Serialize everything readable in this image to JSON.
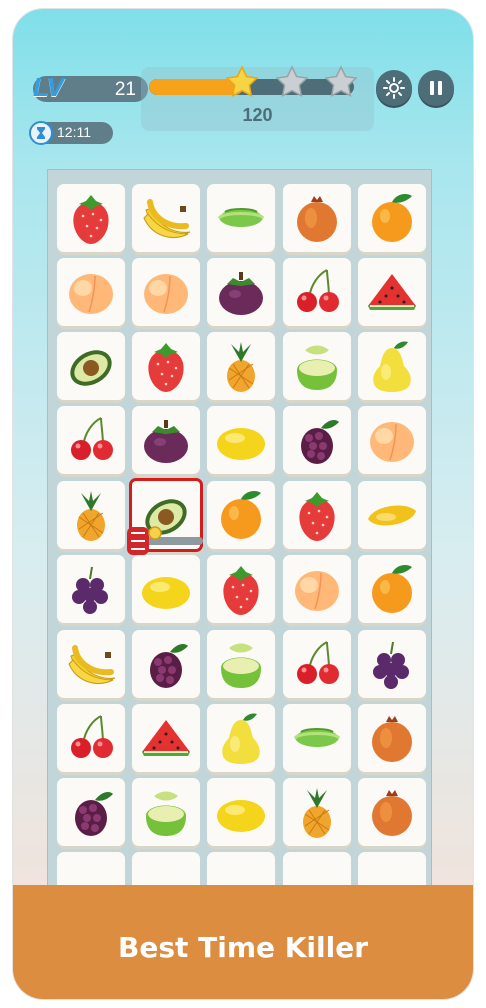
{
  "hud": {
    "level_label": "LV",
    "level": "21",
    "timer": "12:11",
    "score": "120",
    "progress": 0.46,
    "stars_earned": 1,
    "stars_total": 3
  },
  "board": {
    "selected": {
      "row": 4,
      "col": 1
    },
    "rows": [
      [
        "strawberry",
        "banana",
        "starfruit",
        "pomegranate",
        "orange"
      ],
      [
        "peach",
        "peach",
        "mangosteen",
        "cherry",
        "watermelon"
      ],
      [
        "avocado",
        "strawberry",
        "pineapple",
        "guava",
        "pear"
      ],
      [
        "cherry",
        "mangosteen",
        "lemon",
        "blackberry",
        "peach"
      ],
      [
        "pineapple",
        "avocado",
        "orange",
        "strawberry",
        "mango"
      ],
      [
        "grapes",
        "lemon",
        "strawberry",
        "peach",
        "orange"
      ],
      [
        "banana",
        "blackberry",
        "guava",
        "cherry",
        "grapes"
      ],
      [
        "cherry",
        "watermelon",
        "pear",
        "starfruit",
        "pomegranate"
      ],
      [
        "blackberry",
        "guava",
        "lemon",
        "pineapple",
        "pomegranate"
      ]
    ]
  },
  "icons": {
    "settings": "gear-icon",
    "pause": "pause-icon",
    "timer": "hourglass-icon",
    "booster": "hammer-icon"
  },
  "colors": {
    "accent": "#f6a31b",
    "banner": "#dc8d3f",
    "hud": "#4d6d78",
    "selection": "#d31c1c"
  },
  "banner": {
    "title": "Best Time Killer"
  }
}
